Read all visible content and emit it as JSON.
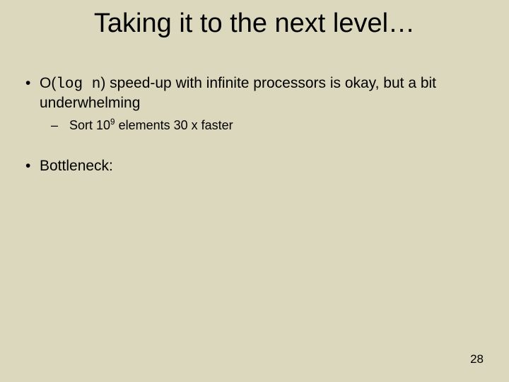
{
  "title": "Taking it to the next level…",
  "bullets": {
    "b1": {
      "dot": "•",
      "pre": "O(",
      "code": "log n",
      "post": ") speed-up with infinite processors is okay, but a bit underwhelming"
    },
    "sub1": {
      "dash": "–",
      "pre": "Sort 10",
      "sup": "9",
      "post": " elements 30 x faster"
    },
    "b2": {
      "dot": "•",
      "text": "Bottleneck:"
    }
  },
  "page_number": "28"
}
